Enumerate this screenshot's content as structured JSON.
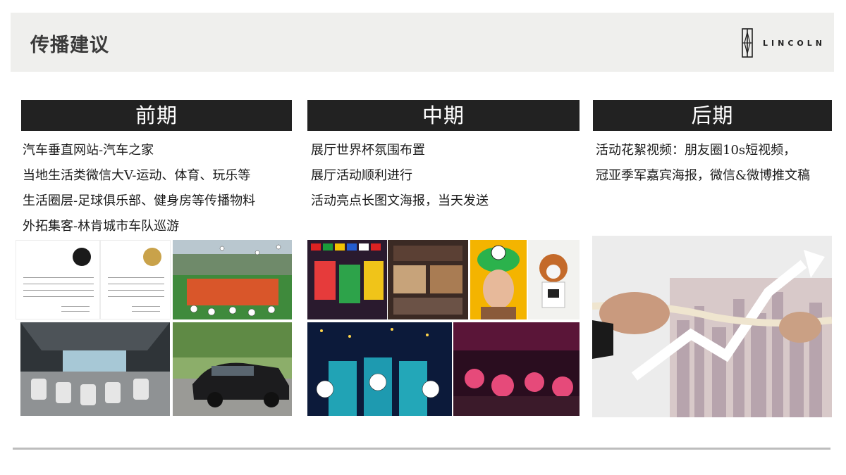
{
  "header": {
    "title": "传播建议",
    "brand": "LINCOLN"
  },
  "columns": [
    {
      "heading": "前期",
      "items": [
        "汽车垂直网站-汽车之家",
        "当地生活类微信大V-运动、体育、玩乐等",
        "生活圈层-足球俱乐部、健身房等传播物料",
        "外拓集客-林肯城市车队巡游"
      ]
    },
    {
      "heading": "中期",
      "items": [
        "展厅世界杯氛围布置",
        "展厅活动顺利进行",
        "活动亮点长图文海报，当天发送"
      ]
    },
    {
      "heading": "后期",
      "items": [
        "活动花絮视频：朋友圈10s短视频，",
        "冠亚季军嘉宾海报，微信&微博推文稿"
      ]
    }
  ],
  "colors": {
    "header_bg": "#efefed",
    "heading_bar": "#222222",
    "footer_rule": "#bdbdbd"
  }
}
